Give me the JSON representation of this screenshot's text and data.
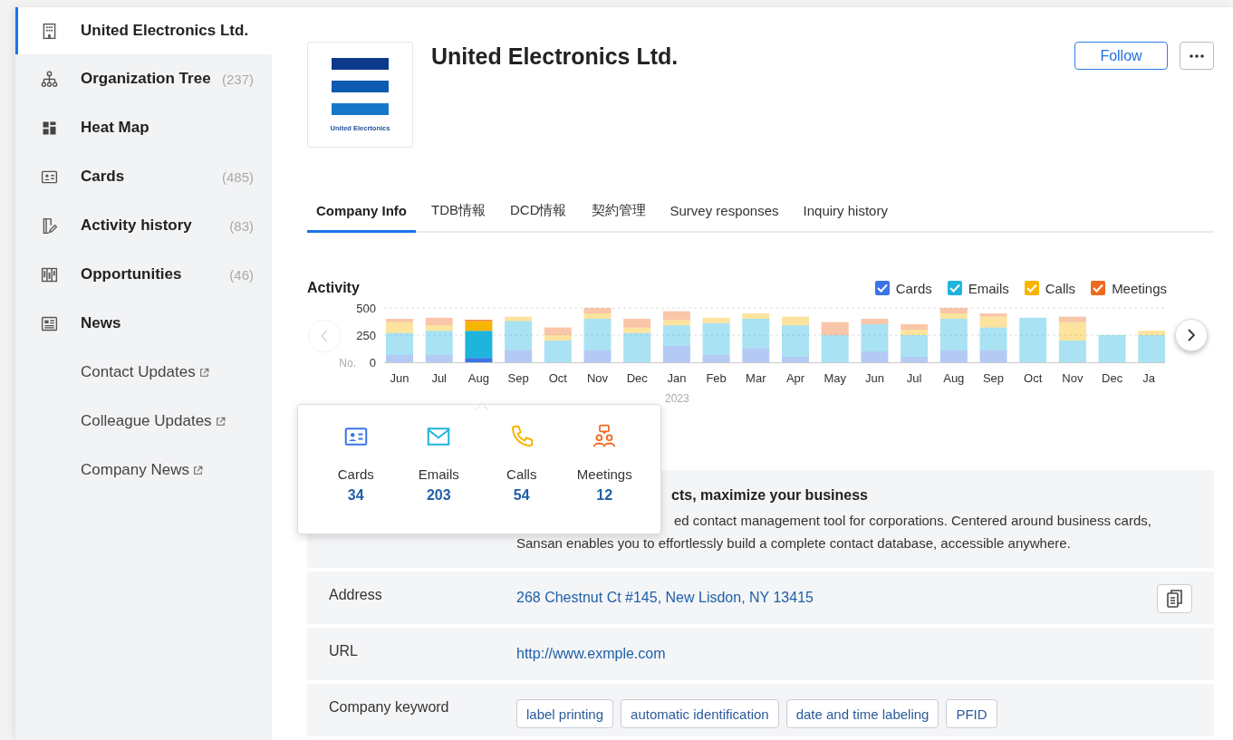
{
  "sidebar": {
    "items": [
      {
        "kind": "main",
        "label": "United Electronics Ltd.",
        "selected": true
      },
      {
        "kind": "main",
        "label": "Organization Tree",
        "count": "(237)",
        "selected": false
      },
      {
        "kind": "main",
        "label": "Heat Map",
        "selected": false
      },
      {
        "kind": "main",
        "label": "Cards",
        "count": "(485)",
        "selected": false
      },
      {
        "kind": "main",
        "label": "Activity history",
        "count": "(83)",
        "selected": false
      },
      {
        "kind": "main",
        "label": "Opportunities",
        "count": "(46)",
        "selected": false
      },
      {
        "kind": "main",
        "label": "News",
        "selected": false
      },
      {
        "kind": "link",
        "label": "Contact Updates",
        "selected": false
      },
      {
        "kind": "link",
        "label": "Colleague Updates",
        "selected": false
      },
      {
        "kind": "link",
        "label": "Company News",
        "selected": false
      }
    ]
  },
  "company": {
    "logo_text": "United Elecrtonics",
    "name": "United Electronics Ltd.",
    "follow_button": "Follow"
  },
  "tabs": [
    {
      "label": "Company Info",
      "selected": true
    },
    {
      "label": "TDB情報",
      "selected": false
    },
    {
      "label": "DCD情報",
      "selected": false
    },
    {
      "label": "契約管理",
      "selected": false
    },
    {
      "label": "Survey responses",
      "selected": false
    },
    {
      "label": "Inquiry history",
      "selected": false
    }
  ],
  "activity": {
    "title": "Activity",
    "legend": [
      {
        "checked": true
      },
      {
        "checked": true
      },
      {
        "checked": true
      },
      {
        "checked": true
      }
    ],
    "y_axis_label": "No.",
    "year_label": "2023",
    "previous_disabled": true,
    "bar_selected": [
      false,
      false,
      true,
      false,
      false,
      false,
      false,
      false,
      false,
      false,
      false,
      false,
      false,
      false,
      false,
      false,
      false,
      false,
      false,
      false
    ],
    "chart_data": {
      "type": "bar",
      "stacked": true,
      "ylim": [
        0,
        500
      ],
      "yticks": [
        0,
        250,
        500
      ],
      "categories": [
        "Jun",
        "Jul",
        "Aug",
        "Sep",
        "Oct",
        "Nov",
        "Dec",
        "Jan",
        "Feb",
        "Mar",
        "Apr",
        "May",
        "Jun",
        "Jul",
        "Aug",
        "Sep",
        "Oct",
        "Nov",
        "Dec",
        "Ja"
      ],
      "series": [
        {
          "name": "Cards",
          "color": "#3b74e6",
          "values": [
            70,
            70,
            40,
            110,
            0,
            110,
            0,
            150,
            70,
            130,
            50,
            0,
            100,
            50,
            110,
            110,
            0,
            0,
            0,
            0
          ]
        },
        {
          "name": "Emails",
          "color": "#1eb4dc",
          "values": [
            200,
            220,
            250,
            270,
            200,
            290,
            270,
            190,
            290,
            270,
            290,
            250,
            250,
            200,
            290,
            210,
            410,
            200,
            250,
            250
          ]
        },
        {
          "name": "Calls",
          "color": "#f7b500",
          "values": [
            100,
            50,
            90,
            40,
            50,
            50,
            50,
            50,
            50,
            50,
            80,
            0,
            0,
            50,
            50,
            100,
            0,
            170,
            0,
            40
          ]
        },
        {
          "name": "Meetings",
          "color": "#f06a1e",
          "values": [
            30,
            70,
            10,
            0,
            70,
            50,
            80,
            80,
            0,
            0,
            0,
            120,
            50,
            50,
            50,
            30,
            0,
            50,
            0,
            0
          ]
        }
      ]
    }
  },
  "tooltip": {
    "items": [
      {
        "kind": "cards",
        "label": "Cards",
        "value": "34"
      },
      {
        "kind": "emails",
        "label": "Emails",
        "value": "203"
      },
      {
        "kind": "calls",
        "label": "Calls",
        "value": "54"
      },
      {
        "kind": "meetings",
        "label": "Meetings",
        "value": "12"
      }
    ]
  },
  "info": {
    "description": {
      "heading": "cts, maximize your business",
      "line_1": "ed contact management tool for corporations. Centered around business cards,",
      "line_2": "Sansan enables you to effortlessly build a complete contact database, accessible anywhere."
    },
    "rows": [
      {
        "kind": "link",
        "label": "Address",
        "value": "268 Chestnut Ct #145, New Lisdon, NY 13415",
        "copy": true
      },
      {
        "kind": "link",
        "label": "URL",
        "value": "http://www.exmple.com",
        "copy": false
      },
      {
        "kind": "tags",
        "label": "Company keyword",
        "tags": [
          "label printing",
          "automatic identification",
          "date and time labeling",
          "PFID"
        ]
      }
    ]
  }
}
